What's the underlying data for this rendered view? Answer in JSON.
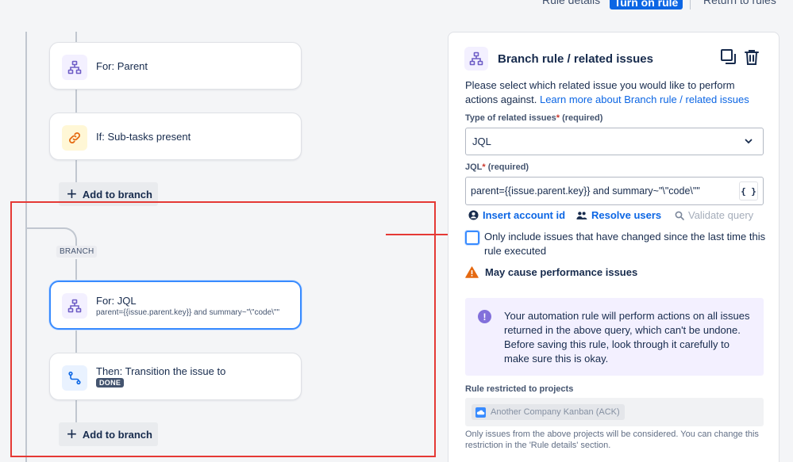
{
  "topbar": {
    "rule_details": "Rule details",
    "turn_on_rule": "Turn on rule",
    "return_to_rules": "Return to rules"
  },
  "canvas": {
    "cards": [
      {
        "title": "For: Parent",
        "icon": "hierarchy-icon"
      },
      {
        "title": "If: Sub-tasks present",
        "icon": "link-icon"
      }
    ],
    "add_branch_label": "Add to branch",
    "branch_tag": "BRANCH",
    "branch_cards": [
      {
        "title": "For: JQL",
        "subtitle": "parent={{issue.parent.key}} and summary~\"\\\"code\\\"\"",
        "icon": "hierarchy-icon",
        "selected": true
      },
      {
        "title": "Then: Transition the issue to",
        "lozenge": "DONE",
        "icon": "transition-icon"
      }
    ],
    "add_branch_label_2": "Add to branch"
  },
  "panel": {
    "title": "Branch rule / related issues",
    "description": "Please select which related issue you would like to perform actions against.",
    "learn_more": "Learn more about Branch rule / related issues",
    "type_label": "Type of related issues",
    "type_required": "(required)",
    "type_value": "JQL",
    "jql_label": "JQL",
    "jql_required": "(required)",
    "jql_value": "parent={{issue.parent.key}} and summary~\"\\\"code\\\"\"",
    "smart_values_button": "{ }",
    "insert_account_id": "Insert account id",
    "resolve_users": "Resolve users",
    "validate_query": "Validate query",
    "checkbox_label": "Only include issues that have changed since the last time this rule executed",
    "warning": "May cause performance issues",
    "info_text": "Your automation rule will perform actions on all issues returned in the above query, which can't be undone. Before saving this rule, look through it carefully to make sure this is okay.",
    "restricted_label": "Rule restricted to projects",
    "project_tag": "Another Company Kanban (ACK)",
    "help_text": "Only issues from the above projects will be considered. You can change this restriction in the 'Rule details' section."
  },
  "colors": {
    "accent": "#0c66e4",
    "annotation_red": "#e53935",
    "info_purple": "#8270db",
    "warning_orange": "#e56910"
  }
}
